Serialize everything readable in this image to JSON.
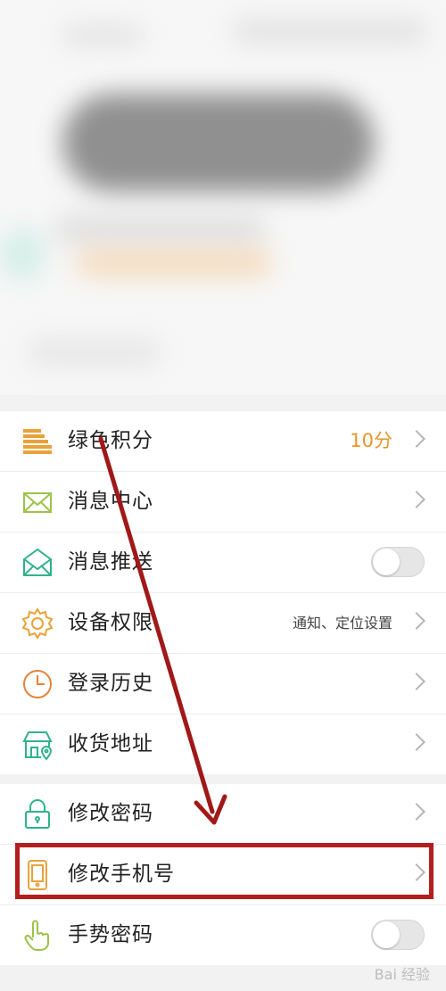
{
  "colors": {
    "accent": "#e8962a",
    "highlight": "#b41e1e",
    "arrow": "#a01818",
    "icon_green": "#2fb28a",
    "icon_orange": "#e8a23a"
  },
  "menu_group1": [
    {
      "label": "绿色积分",
      "value": "10分",
      "icon": "points-coins-icon"
    },
    {
      "label": "消息中心",
      "icon": "envelope-icon"
    },
    {
      "label": "消息推送",
      "icon": "open-envelope-icon",
      "toggle": false
    },
    {
      "label": "设备权限",
      "value": "通知、定位设置",
      "icon": "gear-icon"
    },
    {
      "label": "登录历史",
      "icon": "clock-icon"
    },
    {
      "label": "收货地址",
      "icon": "store-location-icon"
    }
  ],
  "menu_group2": [
    {
      "label": "修改密码",
      "icon": "lock-icon"
    },
    {
      "label": "修改手机号",
      "icon": "phone-icon",
      "highlighted": true
    },
    {
      "label": "手势密码",
      "icon": "hand-gesture-icon",
      "toggle": false
    }
  ],
  "watermark": "Bai 经验"
}
